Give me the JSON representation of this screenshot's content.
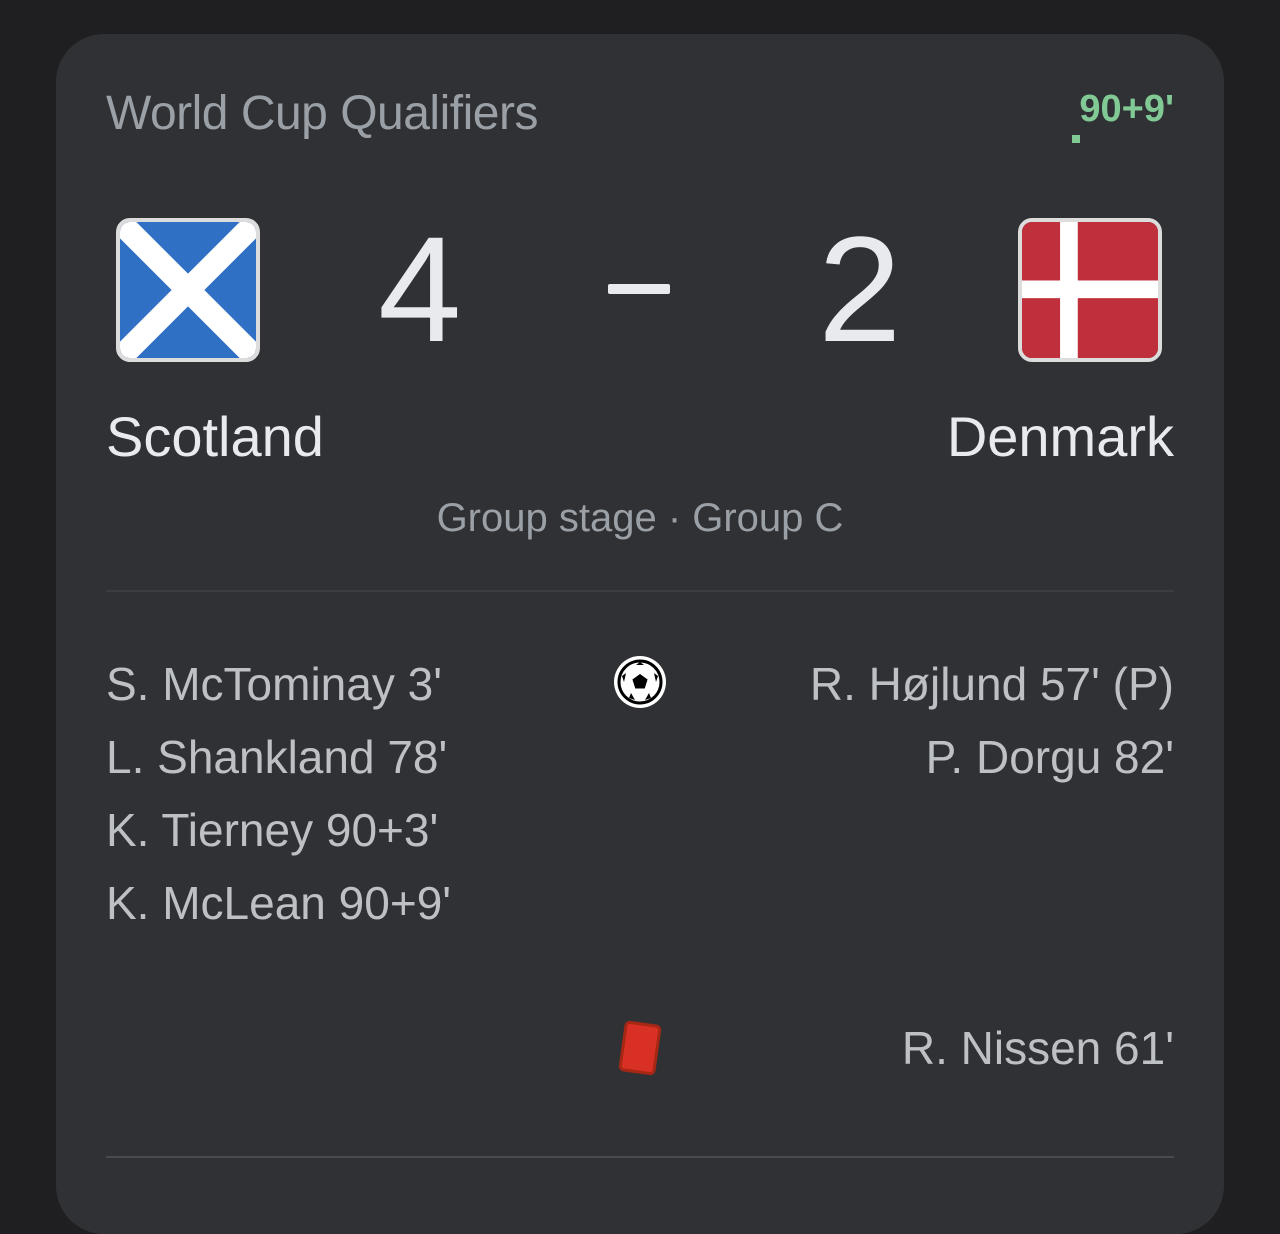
{
  "match": {
    "competition": "World Cup Qualifiers",
    "status": "90+9'",
    "stage": "Group stage · Group C",
    "home": {
      "name": "Scotland",
      "score": "4",
      "flag_icon": "scotland-flag-icon",
      "scorers": [
        "S. McTominay 3'",
        "L. Shankland 78'",
        "K. Tierney 90+3'",
        "K. McLean 90+9'"
      ]
    },
    "away": {
      "name": "Denmark",
      "score": "2",
      "flag_icon": "denmark-flag-icon",
      "scorers": [
        "R. Højlund 57' (P)",
        "P. Dorgu 82'"
      ],
      "red_cards": [
        "R. Nissen 61'"
      ]
    },
    "icons": {
      "goal": "soccer-ball-icon",
      "red_card": "red-card-icon"
    }
  },
  "colors": {
    "background": "#1f1f21",
    "card": "#303134",
    "live": "#81c995",
    "scotland_blue": "#2f6fc4",
    "denmark_red": "#c0303c",
    "red_card": "#d93025"
  }
}
